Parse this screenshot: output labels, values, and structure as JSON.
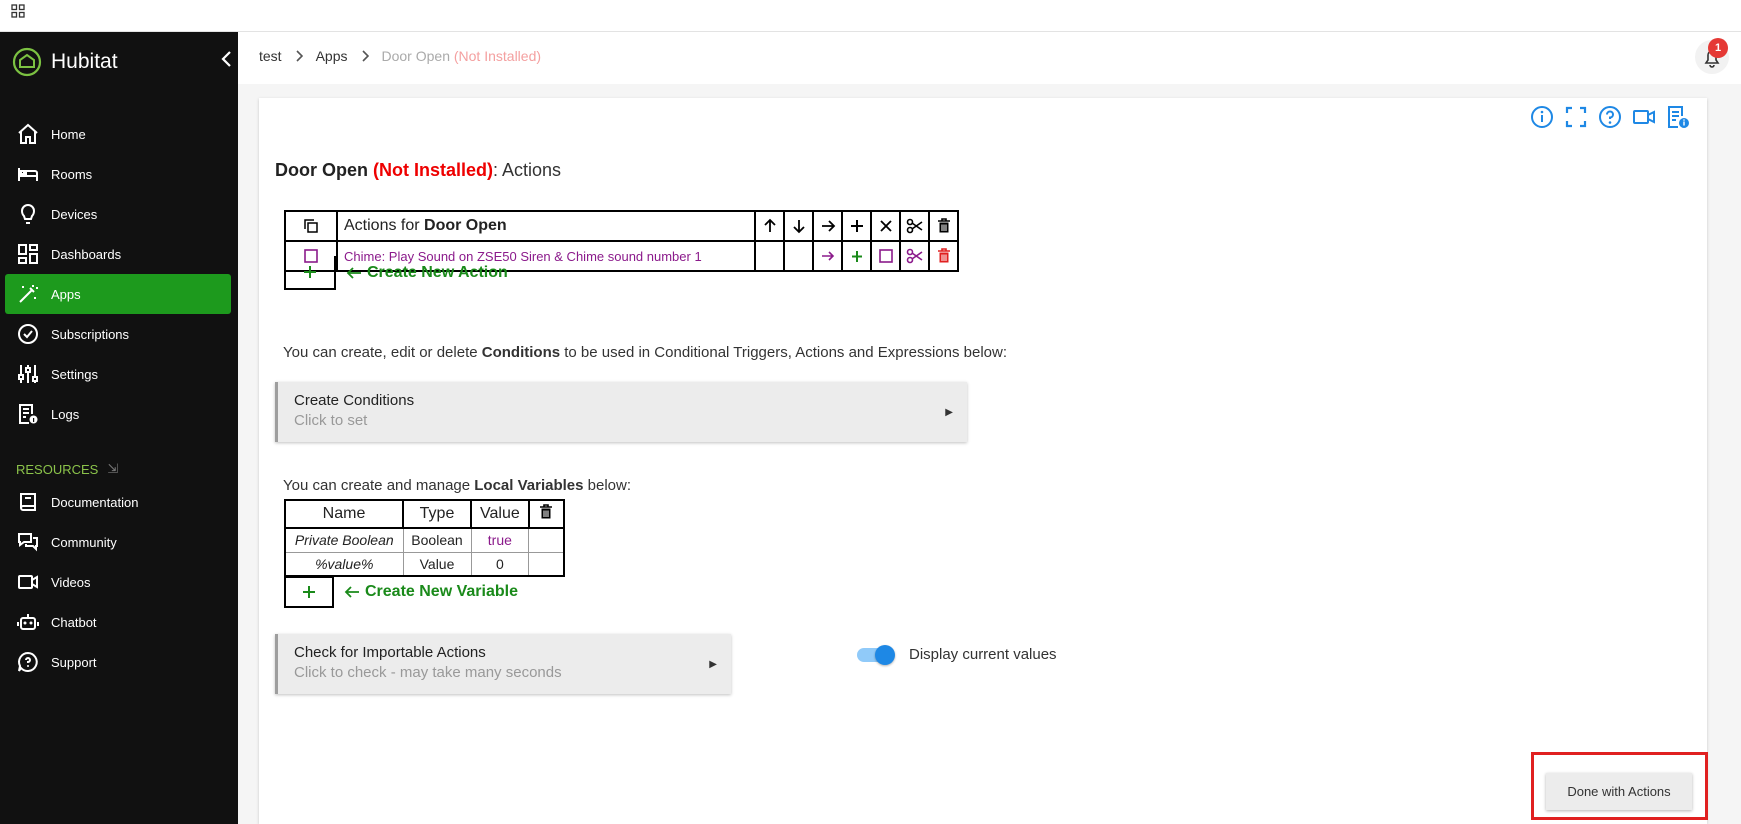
{
  "sidebar": {
    "brand": "Hubitat",
    "items": [
      {
        "label": "Home",
        "icon": "home-icon"
      },
      {
        "label": "Rooms",
        "icon": "bed-icon"
      },
      {
        "label": "Devices",
        "icon": "lightbulb-icon"
      },
      {
        "label": "Dashboards",
        "icon": "dashboard-icon"
      },
      {
        "label": "Apps",
        "icon": "magic-wand-icon",
        "active": true
      },
      {
        "label": "Subscriptions",
        "icon": "check-circle-icon"
      },
      {
        "label": "Settings",
        "icon": "sliders-icon"
      },
      {
        "label": "Logs",
        "icon": "logs-icon"
      }
    ],
    "resources_label": "RESOURCES",
    "resources": [
      {
        "label": "Documentation",
        "icon": "book-icon"
      },
      {
        "label": "Community",
        "icon": "chat-icon"
      },
      {
        "label": "Videos",
        "icon": "video-icon"
      },
      {
        "label": "Chatbot",
        "icon": "robot-icon"
      },
      {
        "label": "Support",
        "icon": "help-bubble-icon"
      }
    ]
  },
  "breadcrumb": {
    "items": [
      "test",
      "Apps"
    ],
    "current": "Door Open",
    "current_status": "(Not Installed)"
  },
  "notifications": {
    "count": "1"
  },
  "page": {
    "title_name": "Door Open",
    "title_status": "(Not Installed)",
    "title_suffix": ": Actions"
  },
  "actions_table": {
    "header_prefix": "Actions for ",
    "header_name": "Door Open",
    "rows": [
      {
        "text": "Chime: Play Sound on ZSE50 Siren & Chime sound number 1"
      }
    ],
    "create_label": "Create New Action"
  },
  "conditions": {
    "intro_pre": "You can create, edit or delete ",
    "intro_bold": "Conditions",
    "intro_post": " to be used in Conditional Triggers, Actions and Expressions below:",
    "box_title": "Create Conditions",
    "box_sub": "Click to set"
  },
  "local_vars": {
    "intro_pre": "You can create and manage ",
    "intro_bold": "Local Variables",
    "intro_post": " below:",
    "headers": [
      "Name",
      "Type",
      "Value"
    ],
    "rows": [
      {
        "name": "Private Boolean",
        "type": "Boolean",
        "value": "true"
      },
      {
        "name": "%value%",
        "type": "Value",
        "value": "0"
      }
    ],
    "create_label": "Create New Variable"
  },
  "importable": {
    "box_title": "Check for Importable Actions",
    "box_sub": "Click to check - may take many seconds"
  },
  "toggle": {
    "label": "Display current values",
    "on": true
  },
  "done_button": "Done with Actions",
  "colors": {
    "accent_green": "#1d9a1d",
    "not_installed_red": "#e00000",
    "action_purple": "#8b1a8b",
    "icon_blue": "#1e88e5"
  }
}
